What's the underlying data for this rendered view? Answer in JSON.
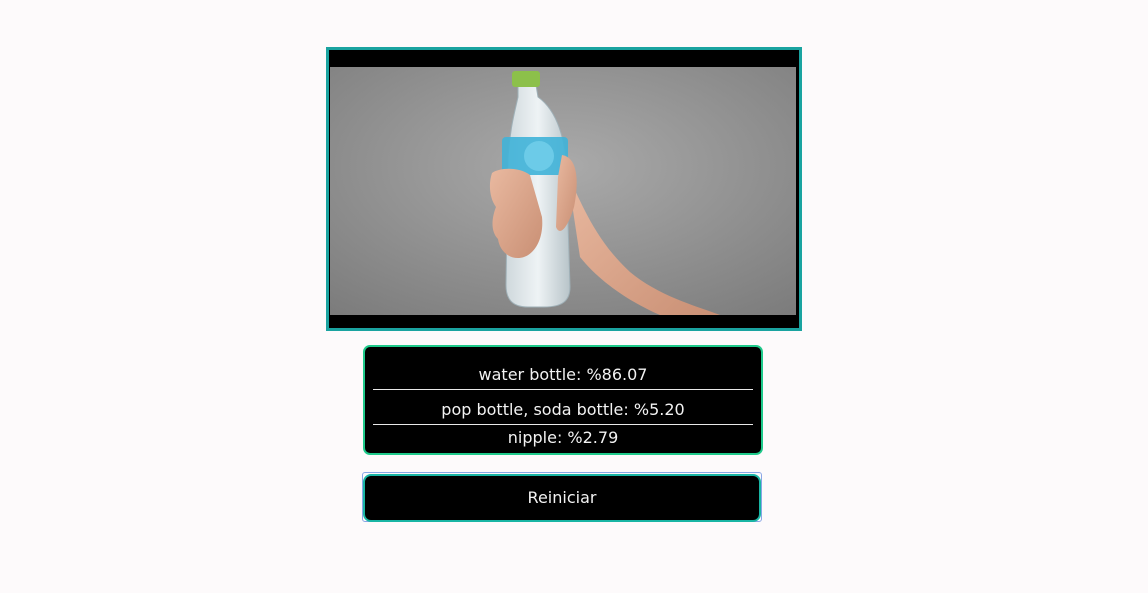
{
  "preview": {
    "image_alt": "hand holding a water bottle"
  },
  "predictions": [
    {
      "label": "water bottle: %86.07"
    },
    {
      "label": "pop bottle, soda bottle: %5.20"
    },
    {
      "label": "nipple: %2.79"
    }
  ],
  "actions": {
    "restart_label": "Reiniciar"
  },
  "colors": {
    "frame_border": "#1aa3a0",
    "panel_border": "#1ec98a",
    "button_border": "#19b5a4",
    "panel_bg": "#000000",
    "page_bg": "#fdfafb"
  }
}
